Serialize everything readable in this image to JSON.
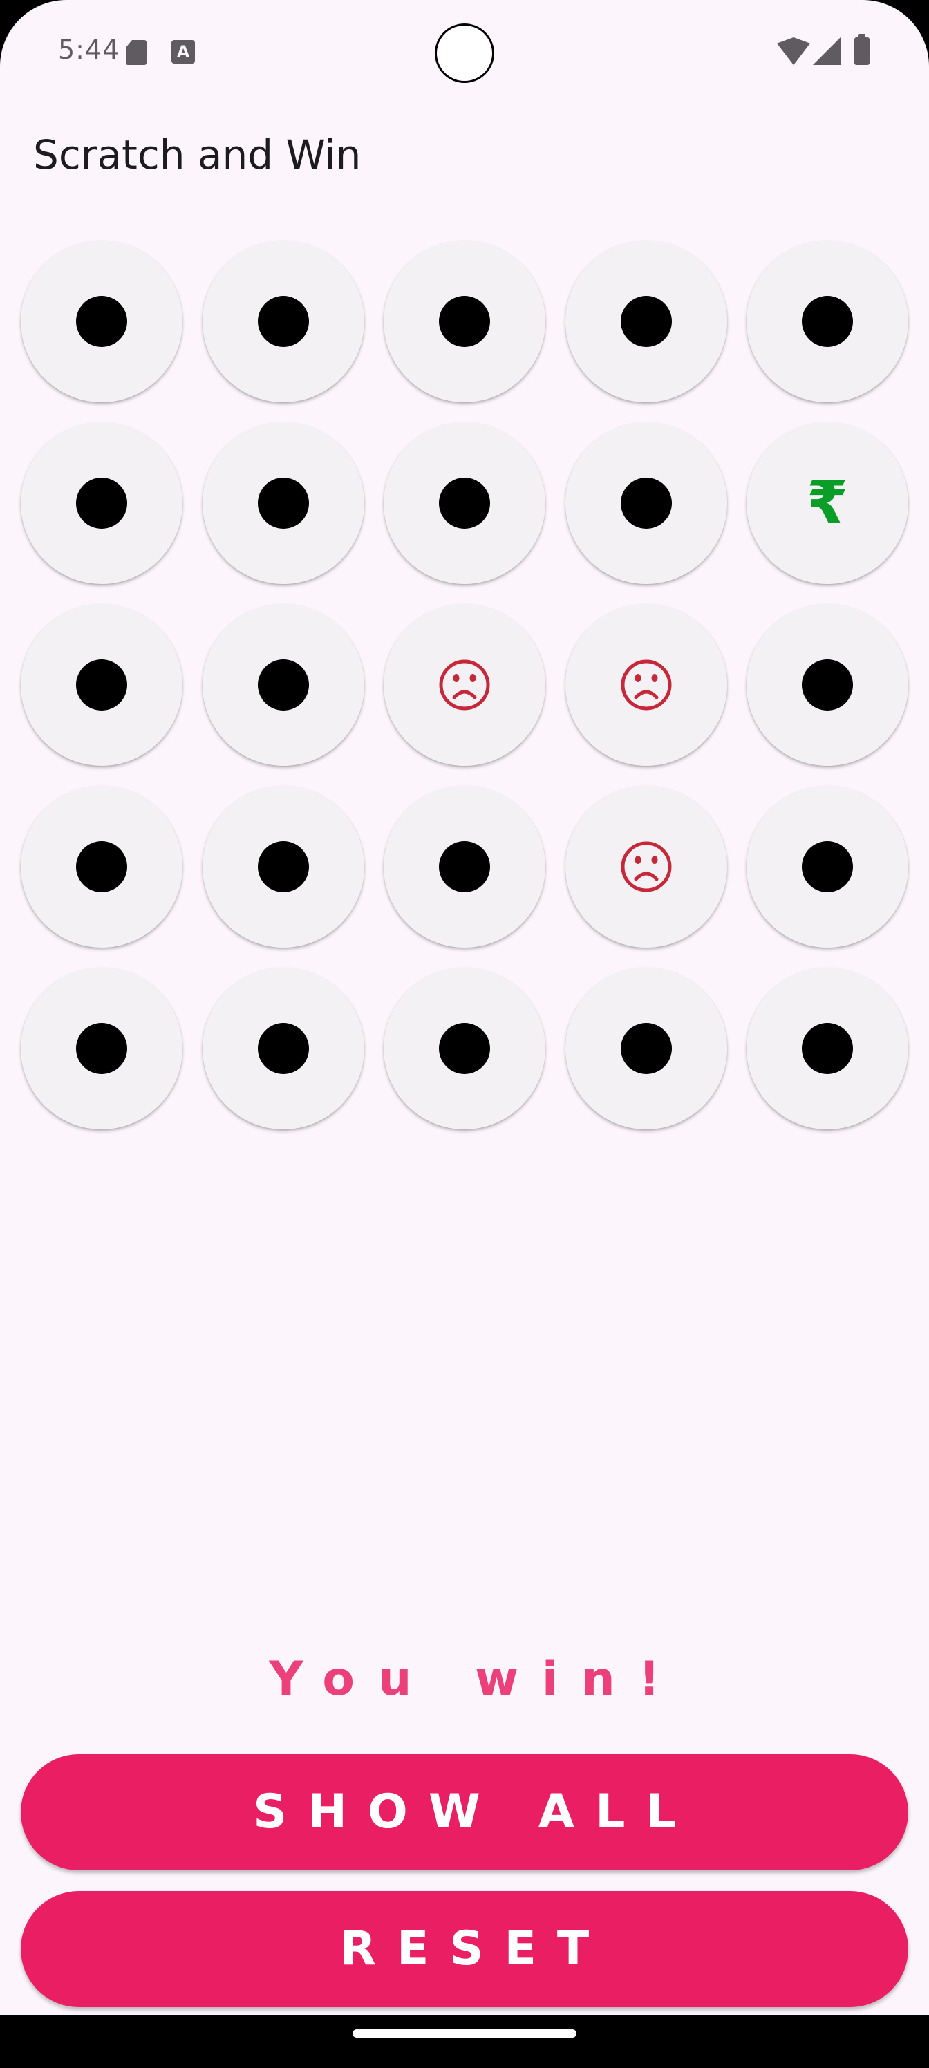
{
  "status_bar": {
    "time": "5:44",
    "a_badge": "A",
    "icons": [
      "sd-card-icon",
      "font-a-icon",
      "wifi-icon",
      "cellular-signal-icon",
      "battery-icon"
    ]
  },
  "app": {
    "title": "Scratch and Win"
  },
  "grid": {
    "rows": [
      [
        "hidden",
        "hidden",
        "hidden",
        "hidden",
        "hidden"
      ],
      [
        "hidden",
        "hidden",
        "hidden",
        "hidden",
        "rupee"
      ],
      [
        "hidden",
        "hidden",
        "sad",
        "sad",
        "hidden"
      ],
      [
        "hidden",
        "hidden",
        "hidden",
        "sad",
        "hidden"
      ],
      [
        "hidden",
        "hidden",
        "hidden",
        "hidden",
        "hidden"
      ]
    ],
    "rupee_symbol": "₹"
  },
  "result": {
    "text": "You win!"
  },
  "buttons": {
    "show_all_label": "SHOW ALL",
    "reset_label": "RESET"
  },
  "colors": {
    "background": "#fcf5fb",
    "accent": "#e91e63",
    "result_text": "#ec407a",
    "rupee": "#0a9e28",
    "sad_face": "#c62839",
    "hidden_dot": "#000000",
    "cell": "#f4f1f5"
  }
}
